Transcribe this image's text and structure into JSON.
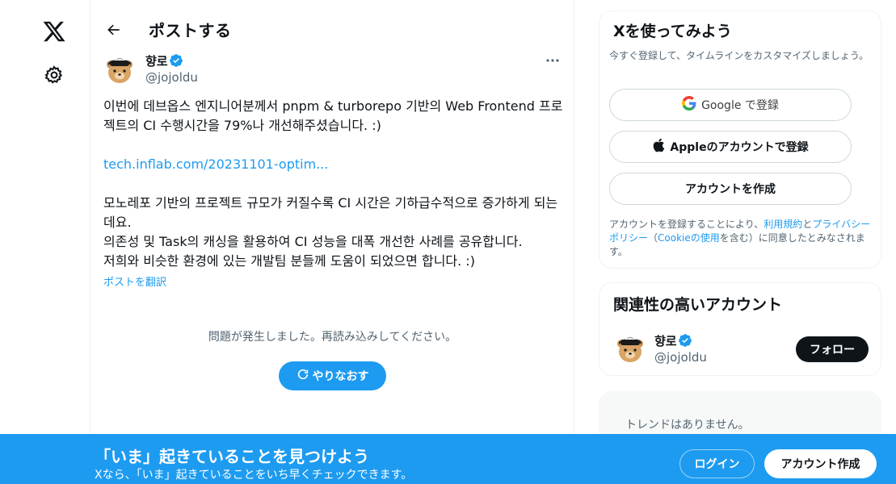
{
  "nav": {
    "logo_icon": "x-logo-icon",
    "settings_icon": "gear-icon"
  },
  "header": {
    "title": "ポストする",
    "back_icon": "arrow-left-icon"
  },
  "post": {
    "author_name": "향로",
    "author_handle": "@jojoldu",
    "verified_icon": "verified-badge-icon",
    "more_icon": "more-horizontal-icon",
    "text_line1": "이번에 데브옵스 엔지니어분께서 pnpm & turborepo 기반의 Web Frontend 프로",
    "text_line2": "젝트의 CI 수행시간을 79%나 개선해주셨습니다. :)",
    "link_text": "tech.inflab.com/20231101-optim...",
    "text_line3": "모노레포 기반의 프로젝트 규모가 커질수록 CI 시간은 기하급수적으로 증가하게 되는",
    "text_line4": "데요.",
    "text_line5": "의존성 및 Task의 캐싱을 활용하여 CI 성능을 대폭 개선한 사례를 공유합니다.",
    "text_line6": "저희와 비슷한 환경에 있는 개발팀 분들께 도움이 되었으면 합니다. :)",
    "translate_label": "ポストを翻訳"
  },
  "error": {
    "message": "問題が発生しました。再読み込みしてください。",
    "retry_label": "やりなおす",
    "retry_icon": "refresh-icon"
  },
  "signup_card": {
    "title": "Xを使ってみよう",
    "subtitle": "今すぐ登録して、タイムラインをカスタマイズしましょう。",
    "google_label": "Google で登録",
    "apple_label": "Appleのアカウントで登録",
    "create_label": "アカウントを作成",
    "terms_prefix": "アカウントを登録することにより、",
    "terms_link": "利用規約",
    "terms_and": "と",
    "privacy_link": "プライバシーポリシー",
    "terms_paren_open": "（",
    "cookie_link": "Cookieの使用",
    "terms_suffix": "を含む）に同意したとみなされます。"
  },
  "related_card": {
    "title": "関連性の高いアカウント",
    "name": "향로",
    "handle": "@jojoldu",
    "follow_label": "フォロー"
  },
  "trends_card": {
    "message": "トレンドはありません。"
  },
  "banner": {
    "title": "「いま」起きていることを見つけよう",
    "subtitle": "Xなら、「いま」起きていることをいち早くチェックできます。",
    "login_label": "ログイン",
    "signup_label": "アカウント作成"
  },
  "colors": {
    "accent": "#1d9bf0",
    "text": "#0f1419",
    "muted": "#536471"
  }
}
